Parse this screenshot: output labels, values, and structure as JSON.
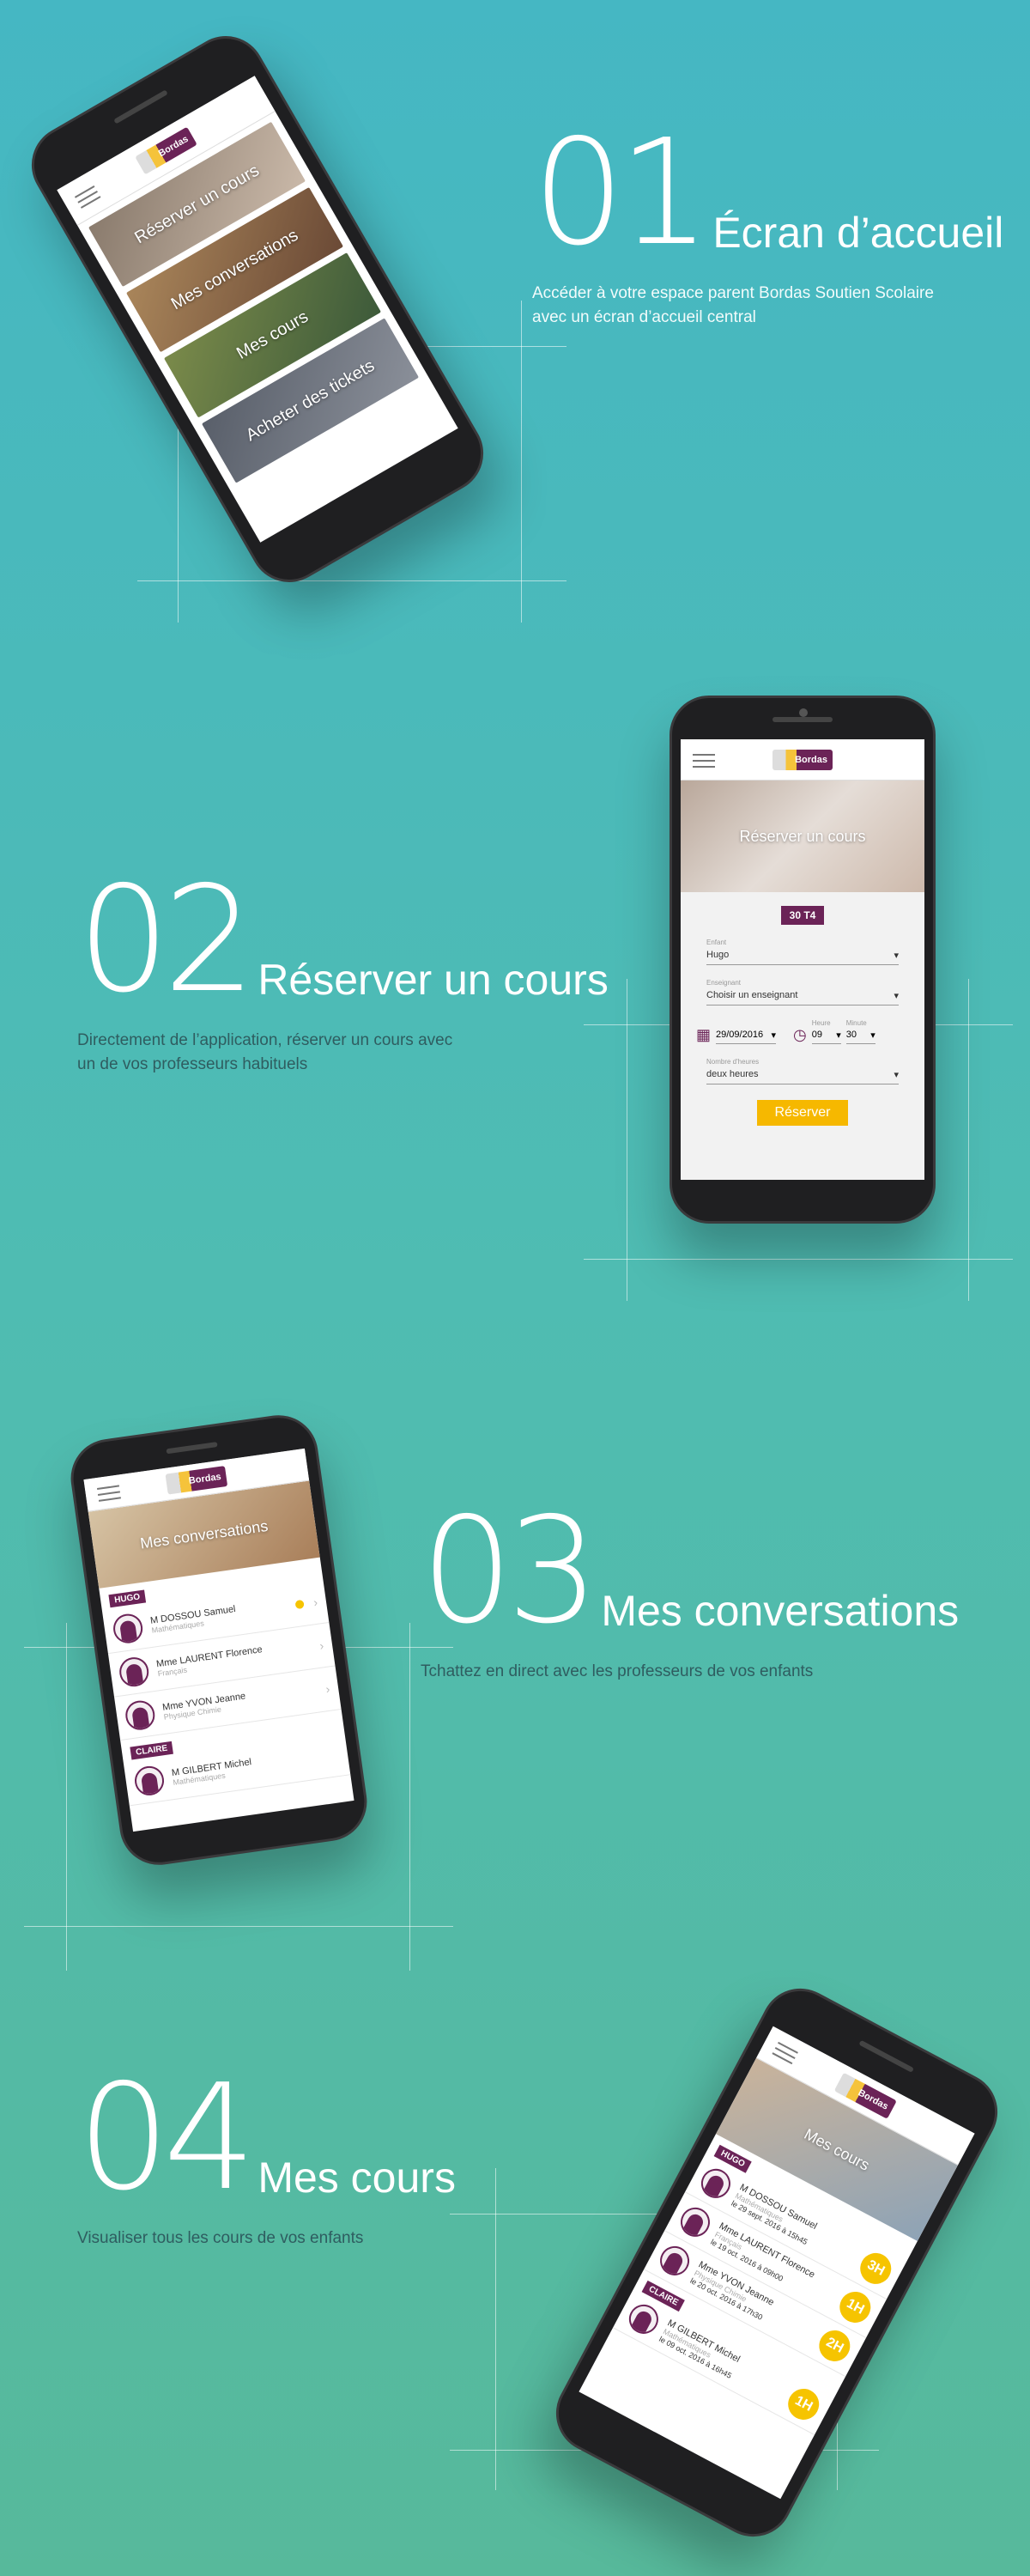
{
  "sections": [
    {
      "number": "01",
      "title": "Écran d’accueil",
      "description_lines": [
        "Accéder à votre espace parent Bordas Soutien Scolaire",
        "avec un écran d’accueil central"
      ]
    },
    {
      "number": "02",
      "title": "Réserver un cours",
      "description_lines": [
        "Directement de l’application, réserver un cours avec",
        "un de vos professeurs habituels"
      ]
    },
    {
      "number": "03",
      "title": "Mes conversations",
      "description_lines": [
        "Tchattez en direct avec les professeurs de vos enfants"
      ]
    },
    {
      "number": "04",
      "title": "Mes cours",
      "description_lines": [
        "Visualiser tous les cours de vos enfants"
      ]
    }
  ],
  "app": {
    "logo_text": "Bordas",
    "logo_sub": "Soutien Scolaire",
    "home_tiles": [
      "Réserver un cours",
      "Mes conversations",
      "Mes cours",
      "Acheter des tickets"
    ],
    "booking": {
      "hero": "Réserver un cours",
      "credit_badge": "30 T4",
      "fields": [
        {
          "label": "Enfant",
          "value": "Hugo"
        },
        {
          "label": "Enseignant",
          "value": "Choisir un enseignant"
        }
      ],
      "date": "29/09/2016",
      "hour_label": "Heure",
      "hour": "09",
      "minute_label": "Minute",
      "minute": "30",
      "duration_label": "Nombre d'heures",
      "duration": "deux heures",
      "submit": "Réserver"
    },
    "conversations": {
      "hero": "Mes conversations",
      "groups": [
        {
          "child": "HUGO",
          "items": [
            {
              "name": "M DOSSOU Samuel",
              "subject": "Mathématiques"
            },
            {
              "name": "Mme LAURENT Florence",
              "subject": "Français"
            },
            {
              "name": "Mme YVON Jeanne",
              "subject": "Physique Chimie"
            }
          ]
        },
        {
          "child": "CLAIRE",
          "items": [
            {
              "name": "M GILBERT Michel",
              "subject": "Mathématiques"
            }
          ]
        }
      ]
    },
    "courses": {
      "hero": "Mes cours",
      "groups": [
        {
          "child": "HUGO",
          "items": [
            {
              "name": "M DOSSOU Samuel",
              "subject": "Mathématiques",
              "date": "le 29 sept. 2016 à 15h45",
              "hours": "3H"
            },
            {
              "name": "Mme LAURENT Florence",
              "subject": "Français",
              "date": "le 19 oct. 2016 à 09h00",
              "hours": "1H"
            },
            {
              "name": "Mme YVON Jeanne",
              "subject": "Physique Chimie",
              "date": "le 20 oct. 2016 à 17h30",
              "hours": "2H"
            }
          ]
        },
        {
          "child": "CLAIRE",
          "items": [
            {
              "name": "M GILBERT Michel",
              "subject": "Mathématiques",
              "date": "le 09 oct. 2016 à 16h45",
              "hours": "1H"
            }
          ]
        }
      ]
    }
  }
}
